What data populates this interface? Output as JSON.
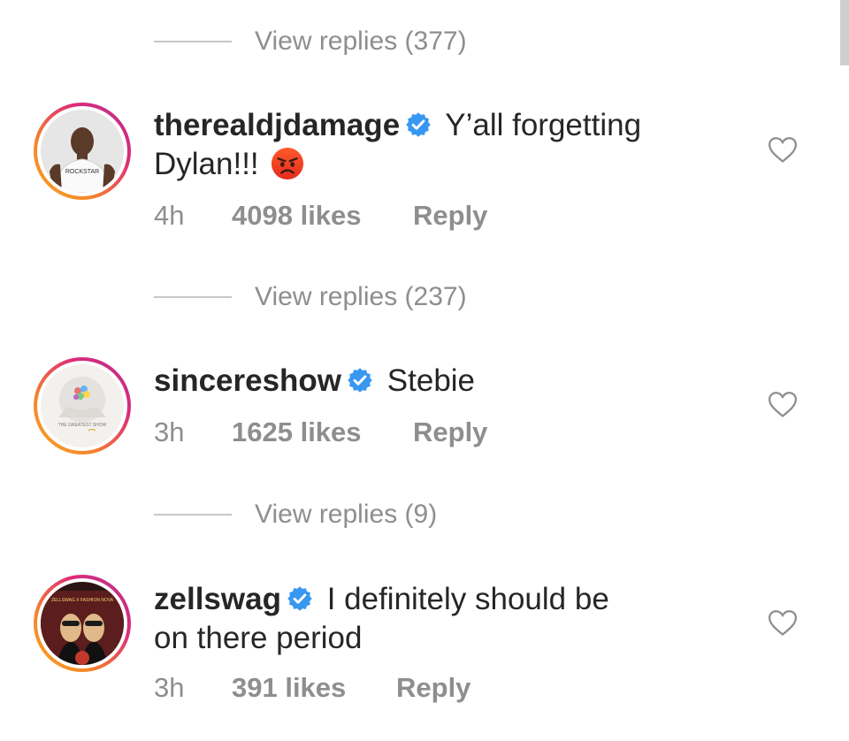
{
  "replies_prefix": "View replies",
  "comments": [
    {
      "view_replies": "View replies (377)",
      "username": "therealdjdamage",
      "text": "Y’all forgetting Dylan!!!",
      "text_line1": "Y’all forgetting",
      "text_line2": "Dylan!!!",
      "emoji": "angry-face",
      "time": "4h",
      "likes": "4098 likes",
      "reply": "Reply",
      "avatar_caption": "ROCKSTAR"
    },
    {
      "view_replies": "View replies (237)",
      "username": "sincereshow",
      "text": "Stebie",
      "time": "3h",
      "likes": "1625 likes",
      "reply": "Reply",
      "avatar_caption": "THE GREATEST SHOW"
    },
    {
      "view_replies": "View replies (9)",
      "username": "zellswag",
      "text": "I definitely should be on there period",
      "text_line1": "I definitely should be",
      "text_line2": "on there period",
      "time": "3h",
      "likes": "391 likes",
      "reply": "Reply",
      "avatar_caption": "ZELLSWAG X FASHION NOVA"
    }
  ],
  "colors": {
    "text": "#262626",
    "muted": "#8e8e8e",
    "verified": "#3897f0",
    "ring_start": "#f9a825",
    "ring_end": "#b1368f"
  }
}
